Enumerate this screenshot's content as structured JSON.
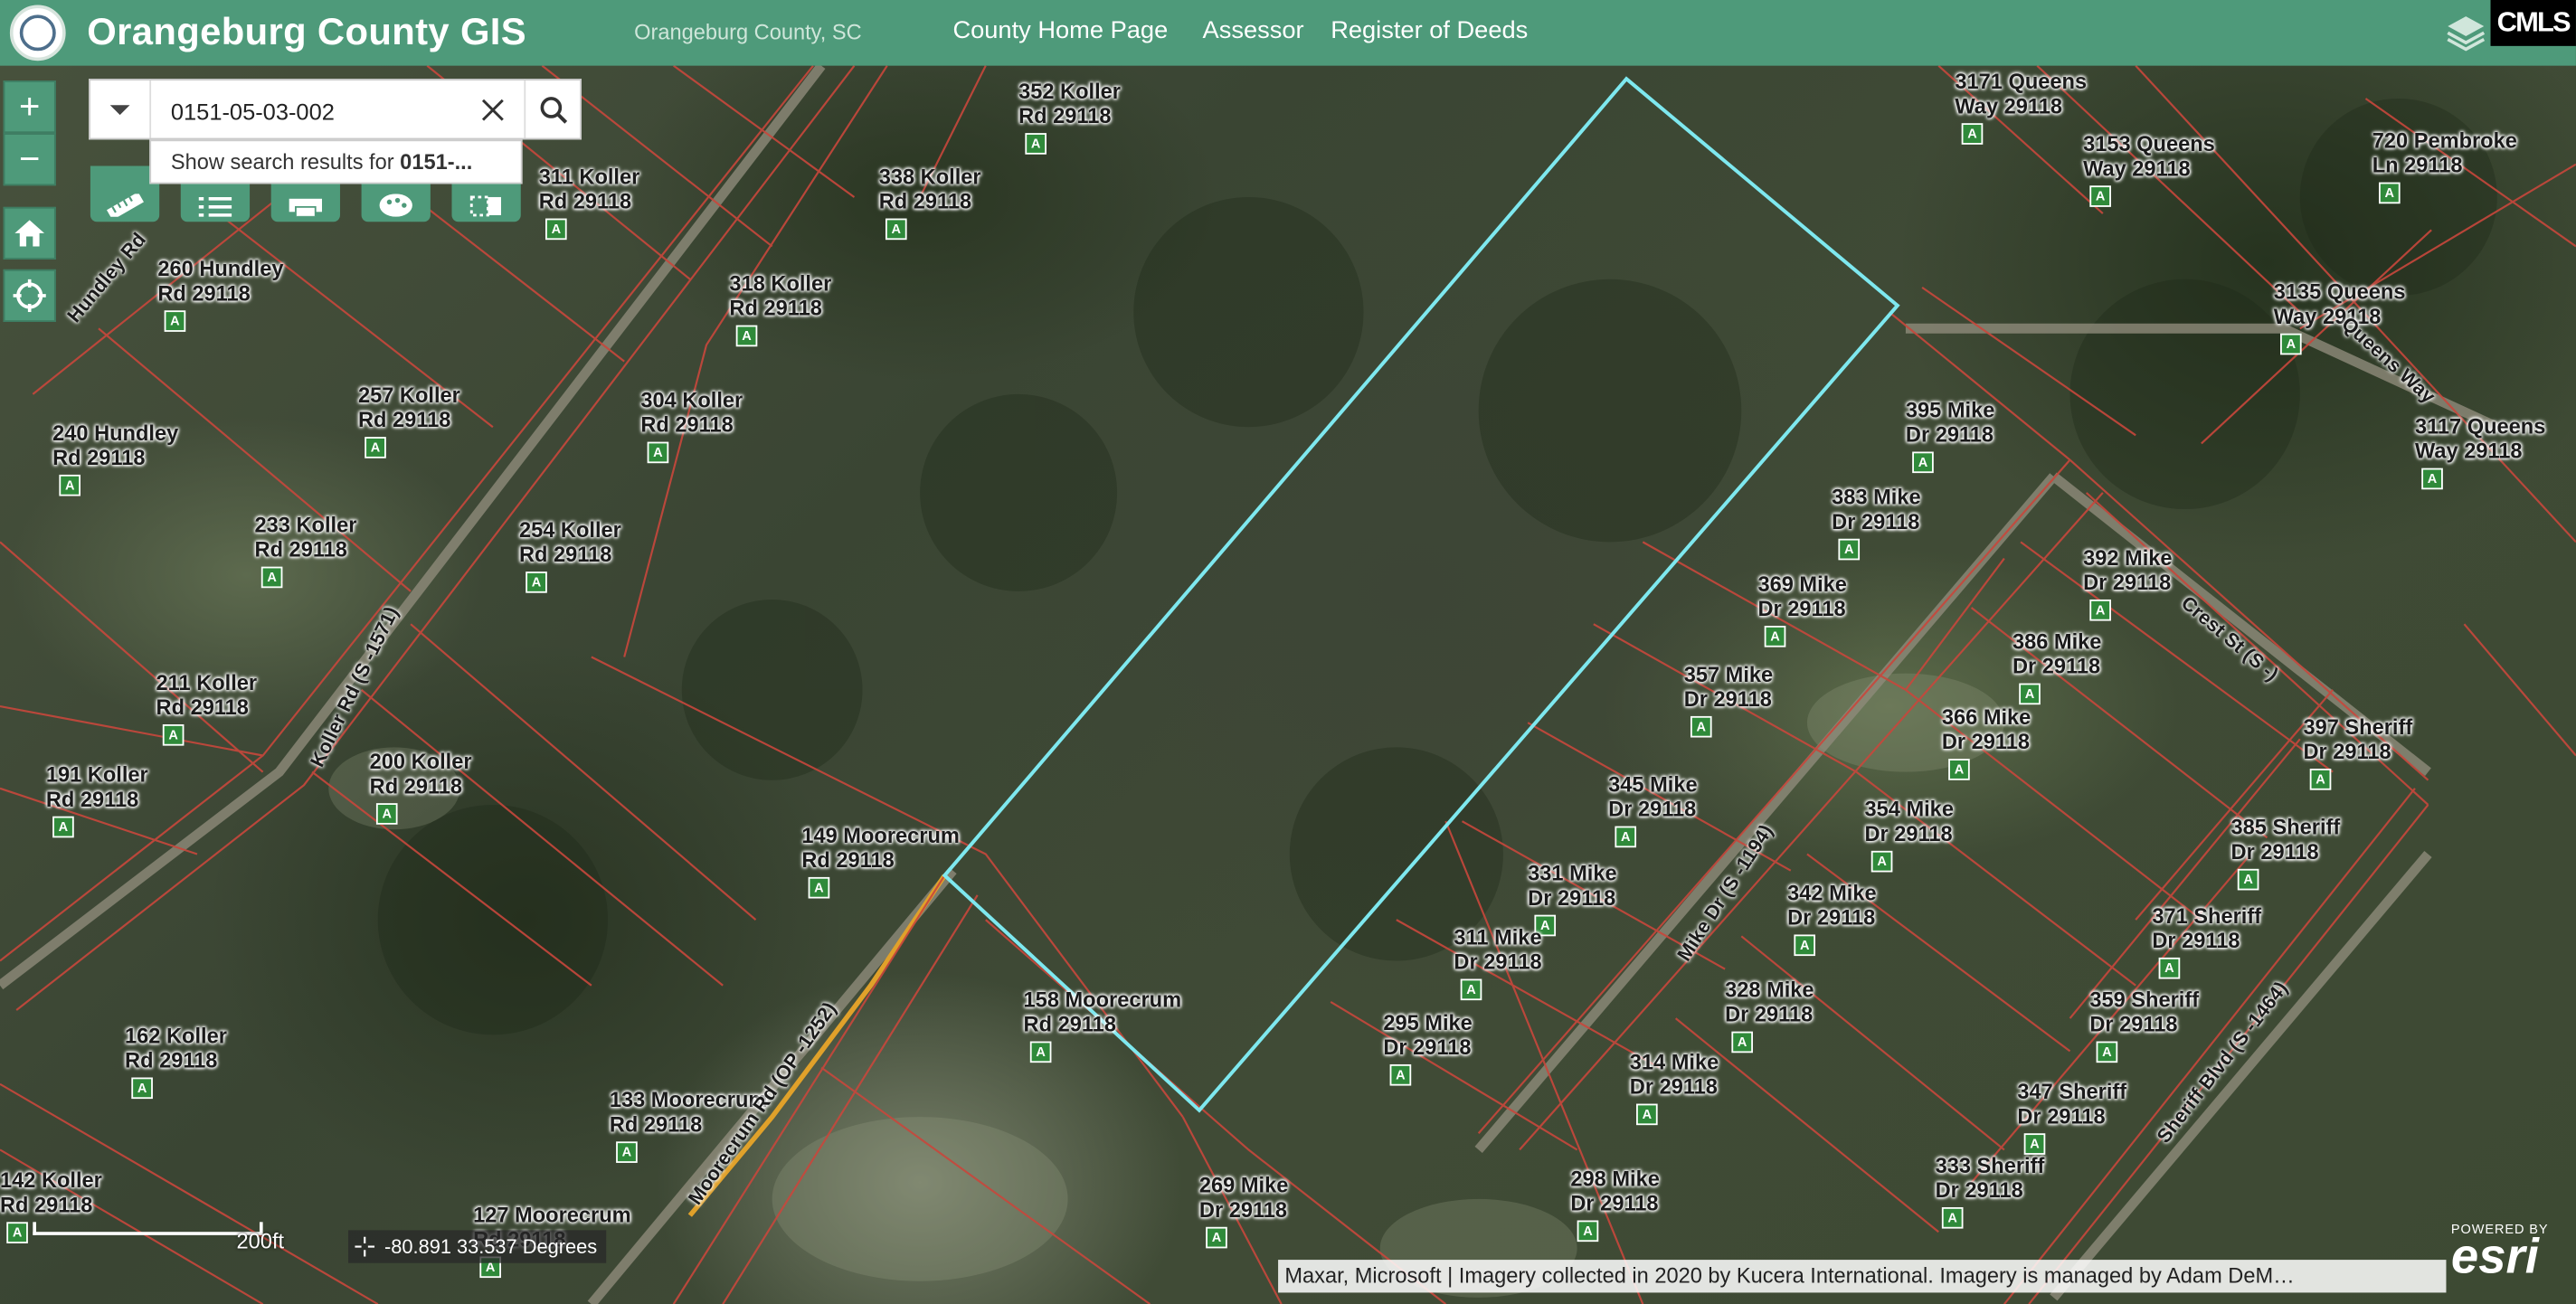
{
  "header": {
    "title": "Orangeburg County GIS",
    "subtitle": "Orangeburg County, SC",
    "links": [
      "County Home Page",
      "Assessor",
      "Register of Deeds"
    ],
    "corner_badge": "CMLS"
  },
  "search": {
    "value": "0151-05-03-002",
    "suggestion_prefix": "Show search results for ",
    "suggestion_term": "0151-..."
  },
  "map_controls": {
    "zoom_in": "+",
    "zoom_out": "−"
  },
  "scale": {
    "label": "200ft"
  },
  "coordinates": {
    "text": "-80.891 33.537 Degrees"
  },
  "attribution": "Maxar, Microsoft | Imagery collected in 2020 by Kucera International. Imagery is managed by Adam DeM…",
  "esri": {
    "powered_by": "POWERED BY",
    "word": "esri"
  },
  "marker_letter": "A",
  "parcel_labels": [
    {
      "line1": "352 Koller",
      "line2": "Rd 29118"
    },
    {
      "line1": "311 Koller",
      "line2": "Rd 29118"
    },
    {
      "line1": "338 Koller",
      "line2": "Rd 29118"
    },
    {
      "line1": "260 Hundley",
      "line2": "Rd 29118"
    },
    {
      "line1": "318 Koller",
      "line2": "Rd 29118"
    },
    {
      "line1": "257 Koller",
      "line2": "Rd 29118"
    },
    {
      "line1": "304 Koller",
      "line2": "Rd 29118"
    },
    {
      "line1": "240 Hundley",
      "line2": "Rd 29118"
    },
    {
      "line1": "233 Koller",
      "line2": "Rd 29118"
    },
    {
      "line1": "254 Koller",
      "line2": "Rd 29118"
    },
    {
      "line1": "211 Koller",
      "line2": "Rd 29118"
    },
    {
      "line1": "191 Koller",
      "line2": "Rd 29118"
    },
    {
      "line1": "200 Koller",
      "line2": "Rd 29118"
    },
    {
      "line1": "149 Moorecrum",
      "line2": "Rd 29118"
    },
    {
      "line1": "162 Koller",
      "line2": "Rd 29118"
    },
    {
      "line1": "158 Moorecrum",
      "line2": "Rd 29118"
    },
    {
      "line1": "133 Moorecrum",
      "line2": "Rd 29118"
    },
    {
      "line1": "142 Koller",
      "line2": "Rd 29118"
    },
    {
      "line1": "127 Moorecrum",
      "line2": "Rd 29118"
    },
    {
      "line1": "3171 Queens",
      "line2": "Way 29118"
    },
    {
      "line1": "3153 Queens",
      "line2": "Way 29118"
    },
    {
      "line1": "720 Pembroke",
      "line2": "Ln 29118"
    },
    {
      "line1": "3135 Queens",
      "line2": "Way 29118"
    },
    {
      "line1": "3117 Queens",
      "line2": "Way 29118"
    },
    {
      "line1": "395 Mike",
      "line2": "Dr 29118"
    },
    {
      "line1": "383 Mike",
      "line2": "Dr 29118"
    },
    {
      "line1": "392 Mike",
      "line2": "Dr 29118"
    },
    {
      "line1": "369 Mike",
      "line2": "Dr 29118"
    },
    {
      "line1": "386 Mike",
      "line2": "Dr 29118"
    },
    {
      "line1": "357 Mike",
      "line2": "Dr 29118"
    },
    {
      "line1": "366 Mike",
      "line2": "Dr 29118"
    },
    {
      "line1": "397 Sheriff",
      "line2": "Dr 29118"
    },
    {
      "line1": "345 Mike",
      "line2": "Dr 29118"
    },
    {
      "line1": "354 Mike",
      "line2": "Dr 29118"
    },
    {
      "line1": "385 Sheriff",
      "line2": "Dr 29118"
    },
    {
      "line1": "331 Mike",
      "line2": "Dr 29118"
    },
    {
      "line1": "342 Mike",
      "line2": "Dr 29118"
    },
    {
      "line1": "371 Sheriff",
      "line2": "Dr 29118"
    },
    {
      "line1": "311 Mike",
      "line2": "Dr 29118"
    },
    {
      "line1": "328 Mike",
      "line2": "Dr 29118"
    },
    {
      "line1": "359 Sheriff",
      "line2": "Dr 29118"
    },
    {
      "line1": "295 Mike",
      "line2": "Dr 29118"
    },
    {
      "line1": "314 Mike",
      "line2": "Dr 29118"
    },
    {
      "line1": "347 Sheriff",
      "line2": "Dr 29118"
    },
    {
      "line1": "298 Mike",
      "line2": "Dr 29118"
    },
    {
      "line1": "333 Sheriff",
      "line2": "Dr 29118"
    },
    {
      "line1": "269 Mike",
      "line2": "Dr 29118"
    }
  ],
  "road_labels": [
    "Koller Rd (S -1571)",
    "Mike Dr (S -1194)",
    "Moorecrum Rd (OP -1252)",
    "Sheriff Blvd (S -1464)",
    "Crest St (S -)",
    "Queens Way",
    "Hundley Rd"
  ]
}
